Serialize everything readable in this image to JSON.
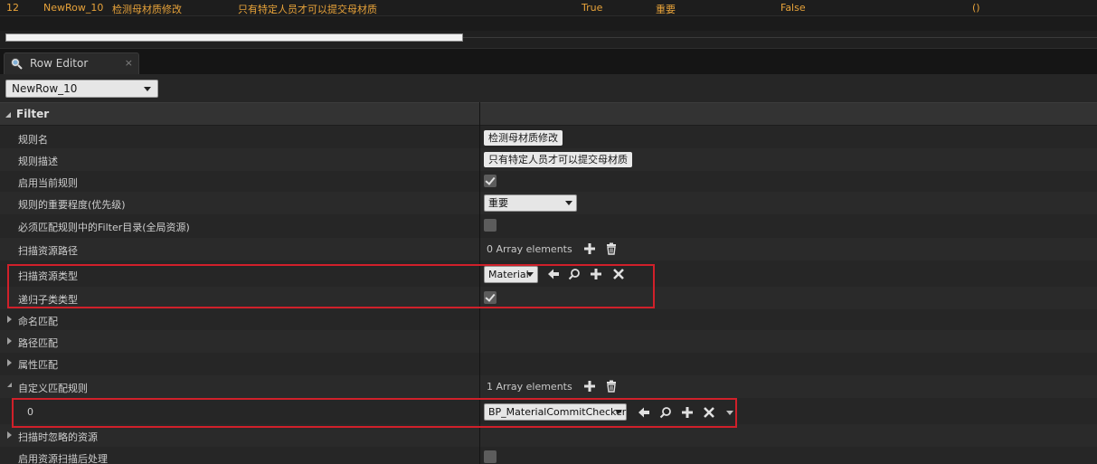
{
  "top_row": {
    "index": "12",
    "row_name": "NewRow_10",
    "rule_name": "检测母材质修改",
    "description": "只有特定人员才可以提交母材质",
    "enabled": "True",
    "priority": "重要",
    "must_match": "False",
    "extra": "()"
  },
  "tab": {
    "label": "Row Editor",
    "close": "×"
  },
  "row_selector": {
    "value": "NewRow_10"
  },
  "category": {
    "label": "Filter"
  },
  "properties": [
    {
      "name": "规则名",
      "value": "检测母材质修改"
    },
    {
      "name": "规则描述",
      "value": "只有特定人员才可以提交母材质"
    },
    {
      "name": "启用当前规则",
      "checked": true
    },
    {
      "name": "规则的重要程度(优先级)",
      "value": "重要"
    },
    {
      "name": "必须匹配规则中的Filter目录(全局资源)",
      "checked": false
    },
    {
      "name": "扫描资源路径",
      "value": "0 Array elements"
    },
    {
      "name": "扫描资源类型",
      "value": "Material"
    },
    {
      "name": "递归子类类型",
      "checked": true
    },
    {
      "name": "命名匹配"
    },
    {
      "name": "路径匹配"
    },
    {
      "name": "属性匹配"
    },
    {
      "name": "自定义匹配规则",
      "value": "1 Array elements"
    },
    {
      "name": "0",
      "value": "BP_MaterialCommitChecker"
    },
    {
      "name": "扫描时忽略的资源"
    },
    {
      "name": "启用资源扫描后处理",
      "checked": false
    }
  ],
  "colors": {
    "accent_orange": "#e8a33a",
    "highlight_red": "#d0202a",
    "panel_bg": "#262626"
  },
  "icons": [
    "magnifier-tab-icon",
    "close-icon",
    "back-arrow-icon",
    "browse-icon",
    "add-icon",
    "clear-icon",
    "trash-icon",
    "dropdown-icon",
    "checkmark-icon"
  ]
}
